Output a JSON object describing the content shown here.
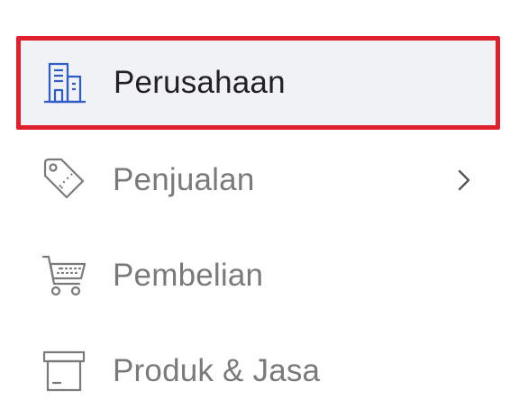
{
  "colors": {
    "active_border": "#e0202c",
    "active_background": "#f1f2f6",
    "active_text": "#222222",
    "inactive_text": "#7a7a7a",
    "active_icon": "#2f5cc8",
    "inactive_icon": "#7a7a7a"
  },
  "menu": {
    "items": [
      {
        "label": "Perusahaan",
        "icon": "building-icon",
        "active": true,
        "has_submenu": false
      },
      {
        "label": "Penjualan",
        "icon": "price-tag-icon",
        "active": false,
        "has_submenu": true
      },
      {
        "label": "Pembelian",
        "icon": "shopping-cart-icon",
        "active": false,
        "has_submenu": false
      },
      {
        "label": "Produk & Jasa",
        "icon": "archive-box-icon",
        "active": false,
        "has_submenu": false
      }
    ]
  }
}
